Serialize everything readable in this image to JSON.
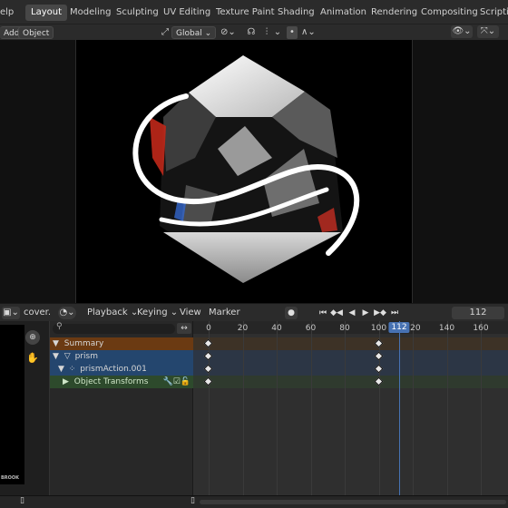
{
  "topbar": {
    "menu_fragment": "elp",
    "tabs": [
      "Layout",
      "Modeling",
      "Sculpting",
      "UV Editing",
      "Texture Paint",
      "Shading",
      "Animation",
      "Rendering",
      "Compositing",
      "Scripting"
    ],
    "active_tab": "Layout"
  },
  "viewport_header": {
    "add_label": "Add",
    "object_label": "Object",
    "orientation_label": "Global"
  },
  "timeline_header": {
    "image_label": "cover.",
    "playback_label": "Playback",
    "keying_label": "Keying",
    "view_label": "View",
    "marker_label": "Marker",
    "current_frame": "112"
  },
  "image_panel": {
    "footer_text": "BROOK"
  },
  "channels": {
    "summary": "Summary",
    "object": "prism",
    "action": "prismAction.001",
    "group": "Object Transforms"
  },
  "dopesheet": {
    "frame_labels": [
      "0",
      "20",
      "40",
      "60",
      "80",
      "100",
      "112",
      "120",
      "140",
      "160"
    ],
    "current_frame": 112,
    "keyframes": [
      0,
      100
    ]
  },
  "colors": {
    "accent_active_frame": "#4772b3",
    "summary_row": "#6b3a12",
    "object_row": "#24466e",
    "action_row": "#24466e",
    "group_row": "#2d4a2c"
  }
}
